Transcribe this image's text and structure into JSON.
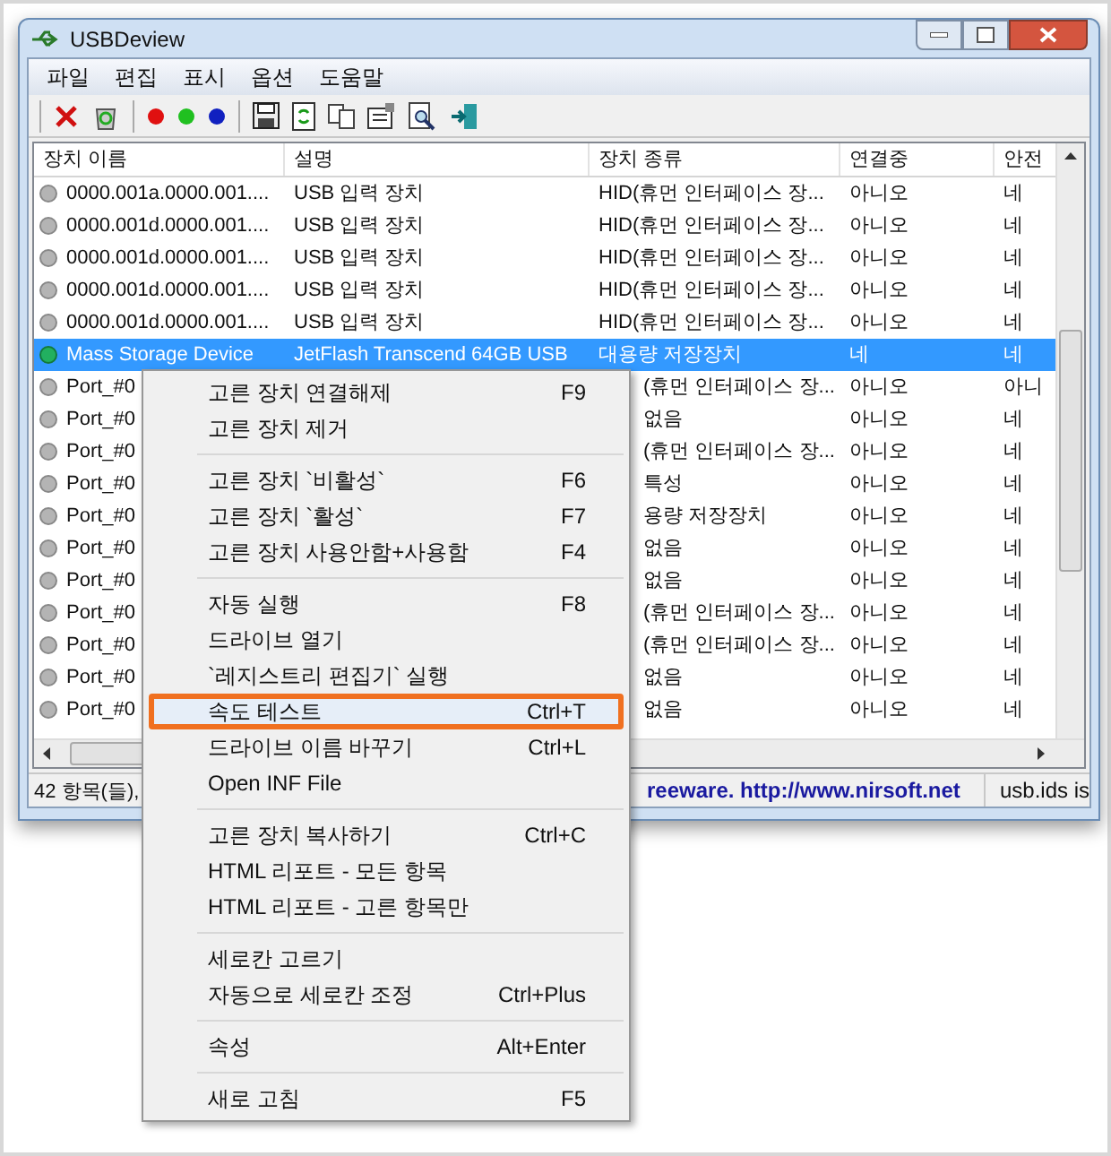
{
  "window": {
    "title": "USBDeview"
  },
  "menu_bar": [
    "파일",
    "편집",
    "표시",
    "옵션",
    "도움말"
  ],
  "table": {
    "columns": [
      "장치 이름",
      "설명",
      "장치 종류",
      "연결중",
      "안전"
    ],
    "rows": [
      {
        "kind": "device",
        "connected": false,
        "selected": false,
        "cells": [
          "0000.001a.0000.001....",
          "USB 입력 장치",
          "HID(휴먼 인터페이스 장...",
          "아니오",
          "네"
        ]
      },
      {
        "kind": "device",
        "connected": false,
        "selected": false,
        "cells": [
          "0000.001d.0000.001....",
          "USB 입력 장치",
          "HID(휴먼 인터페이스 장...",
          "아니오",
          "네"
        ]
      },
      {
        "kind": "device",
        "connected": false,
        "selected": false,
        "cells": [
          "0000.001d.0000.001....",
          "USB 입력 장치",
          "HID(휴먼 인터페이스 장...",
          "아니오",
          "네"
        ]
      },
      {
        "kind": "device",
        "connected": false,
        "selected": false,
        "cells": [
          "0000.001d.0000.001....",
          "USB 입력 장치",
          "HID(휴먼 인터페이스 장...",
          "아니오",
          "네"
        ]
      },
      {
        "kind": "device",
        "connected": false,
        "selected": false,
        "cells": [
          "0000.001d.0000.001....",
          "USB 입력 장치",
          "HID(휴먼 인터페이스 장...",
          "아니오",
          "네"
        ]
      },
      {
        "kind": "device",
        "connected": true,
        "selected": true,
        "cells": [
          "Mass Storage Device",
          "JetFlash Transcend 64GB USB",
          "대용량 저장장치",
          "네",
          "네"
        ]
      },
      {
        "kind": "port",
        "connected": false,
        "selected": false,
        "cells": [
          "Port_#0",
          "(휴먼 인터페이스 장...",
          "아니오",
          "아니"
        ]
      },
      {
        "kind": "port",
        "connected": false,
        "selected": false,
        "cells": [
          "Port_#0",
          "없음",
          "아니오",
          "네"
        ]
      },
      {
        "kind": "port",
        "connected": false,
        "selected": false,
        "cells": [
          "Port_#0",
          "(휴먼 인터페이스 장...",
          "아니오",
          "네"
        ]
      },
      {
        "kind": "port",
        "connected": false,
        "selected": false,
        "cells": [
          "Port_#0",
          "특성",
          "아니오",
          "네"
        ]
      },
      {
        "kind": "port",
        "connected": false,
        "selected": false,
        "cells": [
          "Port_#0",
          "용량 저장장치",
          "아니오",
          "네"
        ]
      },
      {
        "kind": "port",
        "connected": false,
        "selected": false,
        "cells": [
          "Port_#0",
          "없음",
          "아니오",
          "네"
        ]
      },
      {
        "kind": "port",
        "connected": false,
        "selected": false,
        "cells": [
          "Port_#0",
          "없음",
          "아니오",
          "네"
        ]
      },
      {
        "kind": "port",
        "connected": false,
        "selected": false,
        "cells": [
          "Port_#0",
          "(휴먼 인터페이스 장...",
          "아니오",
          "네"
        ]
      },
      {
        "kind": "port",
        "connected": false,
        "selected": false,
        "cells": [
          "Port_#0",
          "(휴먼 인터페이스 장...",
          "아니오",
          "네"
        ]
      },
      {
        "kind": "port",
        "connected": false,
        "selected": false,
        "cells": [
          "Port_#0",
          "없음",
          "아니오",
          "네"
        ]
      },
      {
        "kind": "port",
        "connected": false,
        "selected": false,
        "cells": [
          "Port_#0",
          "없음",
          "아니오",
          "네"
        ]
      }
    ]
  },
  "status_bar": {
    "count": "42 항목(들),",
    "link": "reeware.  http://www.nirsoft.net",
    "note": "usb.ids is"
  },
  "context_menu": [
    [
      {
        "label": "고른 장치 연결해제",
        "shortcut": "F9",
        "selected": false
      },
      {
        "label": "고른 장치 제거",
        "selected": false
      }
    ],
    [
      {
        "label": "고른 장치 `비활성`",
        "shortcut": "F6",
        "selected": false
      },
      {
        "label": "고른 장치 `활성`",
        "shortcut": "F7",
        "selected": false
      },
      {
        "label": "고른 장치 사용안함+사용함",
        "shortcut": "F4",
        "selected": false
      }
    ],
    [
      {
        "label": "자동 실행",
        "shortcut": "F8",
        "selected": false
      },
      {
        "label": "드라이브 열기",
        "selected": false
      },
      {
        "label": "`레지스트리 편집기` 실행",
        "selected": false
      },
      {
        "label": "속도 테스트",
        "shortcut": "Ctrl+T",
        "selected": true
      },
      {
        "label": "드라이브 이름 바꾸기",
        "shortcut": "Ctrl+L",
        "selected": false
      },
      {
        "label": "Open INF File",
        "selected": false
      }
    ],
    [
      {
        "label": "고른 장치 복사하기",
        "shortcut": "Ctrl+C",
        "selected": false
      },
      {
        "label": "HTML 리포트 - 모든 항목",
        "selected": false
      },
      {
        "label": "HTML 리포트 - 고른 항목만",
        "selected": false
      }
    ],
    [
      {
        "label": "세로칸 고르기",
        "selected": false
      },
      {
        "label": "자동으로 세로칸 조정",
        "shortcut": "Ctrl+Plus",
        "selected": false
      }
    ],
    [
      {
        "label": "속성",
        "shortcut": "Alt+Enter",
        "selected": false
      }
    ],
    [
      {
        "label": "새로 고침",
        "shortcut": "F5",
        "selected": false
      }
    ]
  ]
}
